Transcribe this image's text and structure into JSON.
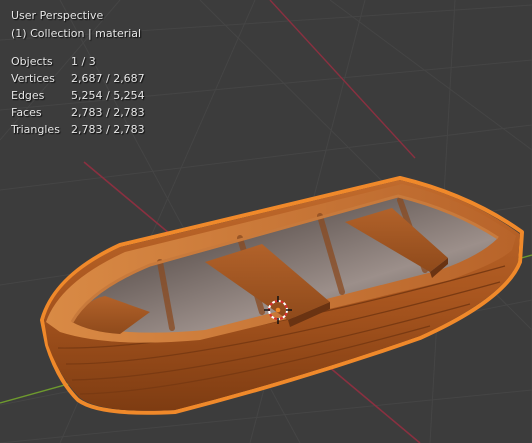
{
  "viewport": {
    "view_name": "User Perspective",
    "collection_info": "(1) Collection | material",
    "background": "#3c3c3c",
    "grid_color": "#444444",
    "x_axis_color": "#8a3040",
    "y_axis_color": "#6e9a2e",
    "selection_outline_color": "#f0892a"
  },
  "stats": [
    {
      "label": "Objects",
      "value": "1 / 3"
    },
    {
      "label": "Vertices",
      "value": "2,687 / 2,687"
    },
    {
      "label": "Edges",
      "value": "5,254 / 5,254"
    },
    {
      "label": "Faces",
      "value": "2,783 / 2,783"
    },
    {
      "label": "Triangles",
      "value": "2,783 / 2,783"
    }
  ],
  "scene": {
    "object": "boat",
    "object_color": "#a4521c",
    "origin_marker": "3d-cursor-icon"
  }
}
